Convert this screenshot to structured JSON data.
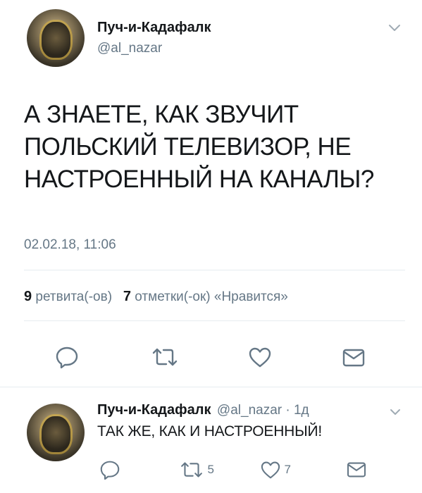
{
  "tweet": {
    "author_name": "Пуч-и-Кадафалк",
    "author_handle": "@al_nazar",
    "text_lines": [
      "А ЗНАЕТЕ, КАК ЗВУЧИТ",
      "ПОЛЬСКИЙ ТЕЛЕВИЗОР, НЕ",
      "НАСТРОЕННЫЙ НА КАНАЛЫ?"
    ],
    "timestamp": "02.02.18, 11:06",
    "retweet_count": "9",
    "retweet_label": "ретвита(-ов)",
    "like_count": "7",
    "like_label": "отметки(-ок) «Нравится»",
    "icons": [
      "reply-icon",
      "retweet-icon",
      "heart-icon",
      "message-icon",
      "chevron-down-icon"
    ]
  },
  "reply": {
    "author_name": "Пуч-и-Кадафалк",
    "meta": "@al_nazar · 1д",
    "text": "ТАК ЖЕ, КАК И НАСТРОЕННЫЙ!",
    "retweet_count": "5",
    "like_count": "7"
  },
  "colors": {
    "text": "#14171a",
    "secondary": "#657786",
    "icon": "#657786",
    "divider": "#e6ecf0"
  }
}
